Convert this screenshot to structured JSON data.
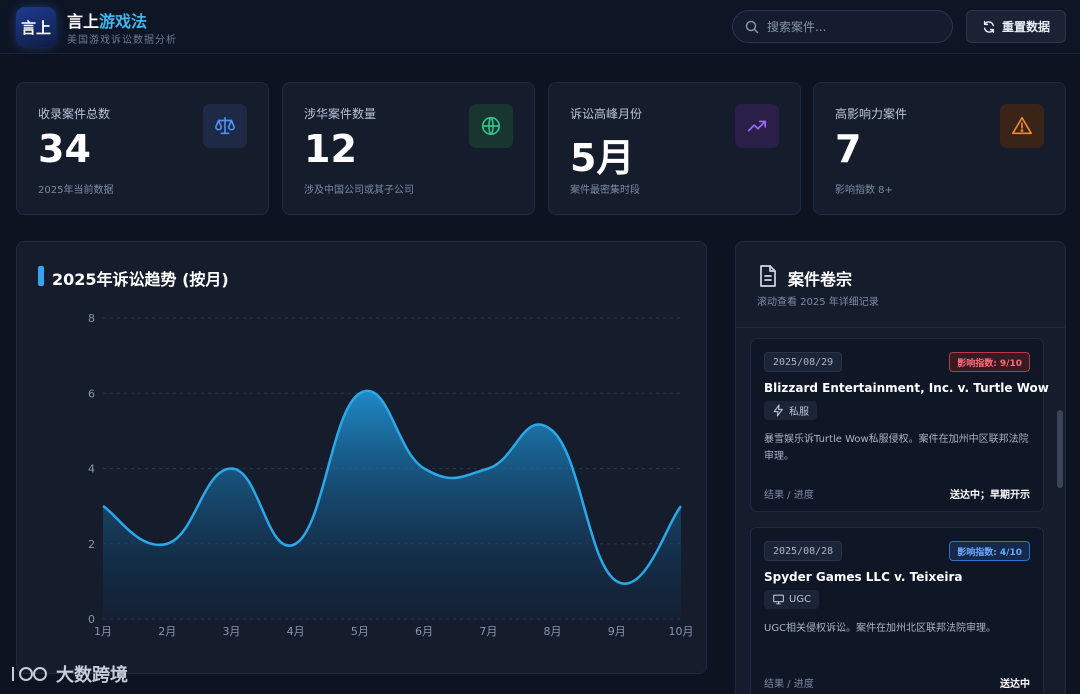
{
  "header": {
    "logo_text": "言上",
    "brand_prefix": "言上",
    "brand_accent": "游戏法",
    "brand_subtitle": "美国游戏诉讼数据分析",
    "search_placeholder": "搜索案件...",
    "reset_label": "重置数据"
  },
  "stats": [
    {
      "label": "收录案件总数",
      "value": "34",
      "note": "2025年当前数据",
      "icon": "scale-icon",
      "color": "#4e8ff0"
    },
    {
      "label": "涉华案件数量",
      "value": "12",
      "note": "涉及中国公司或其子公司",
      "icon": "globe-icon",
      "color": "#33c08a"
    },
    {
      "label": "诉讼高峰月份",
      "value": "5月",
      "note": "案件最密集时段",
      "icon": "trending-up-icon",
      "color": "#a46bff"
    },
    {
      "label": "高影响力案件",
      "value": "7",
      "note": "影响指数 8+",
      "icon": "warning-icon",
      "color": "#f2872e"
    }
  ],
  "chart_data": {
    "type": "area",
    "title": "2025年诉讼趋势 (按月)",
    "categories": [
      "1月",
      "2月",
      "3月",
      "4月",
      "5月",
      "6月",
      "7月",
      "8月",
      "9月",
      "10月"
    ],
    "values": [
      3,
      2,
      4,
      2,
      6,
      4,
      4,
      5,
      1,
      3
    ],
    "ylim": [
      0,
      8
    ],
    "yticks": [
      0,
      2,
      4,
      6,
      8
    ],
    "grid": true,
    "legend": "none",
    "color": "#2aa8e8"
  },
  "cases_panel": {
    "title": "案件卷宗",
    "subtitle": "滚动查看 2025 年详细记录",
    "cases": [
      {
        "date": "2025/08/29",
        "impact": "影响指数: 9/10",
        "name": "Blizzard Entertainment, Inc. v. Turtle Wow",
        "tag": "私服",
        "tag_icon": "lightning-icon",
        "desc": "暴雪娱乐诉Turtle Wow私服侵权。案件在加州中区联邦法院审理。",
        "result_label": "结果 / 进度",
        "result": "送达中；早期开示"
      },
      {
        "date": "2025/08/28",
        "impact": "影响指数: 4/10",
        "name": "Spyder Games LLC v. Teixeira",
        "tag": "UGC",
        "tag_icon": "monitor-icon",
        "desc": "UGC相关侵权诉讼。案件在加州北区联邦法院审理。",
        "result_label": "结果 / 进度",
        "result": "送达中"
      }
    ]
  },
  "watermark": {
    "text": "大数跨境"
  }
}
